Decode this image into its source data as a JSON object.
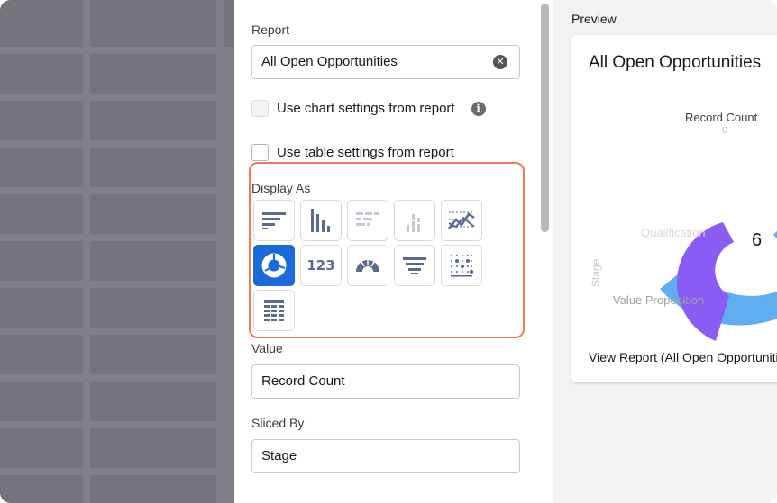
{
  "report": {
    "label": "Report",
    "value": "All Open Opportunities",
    "clear_icon": "clear-icon"
  },
  "options": {
    "chart_settings_label": "Use chart settings from report",
    "table_settings_label": "Use table settings from report"
  },
  "display_as": {
    "label": "Display As",
    "icons": [
      "horizontal-bar-icon",
      "vertical-bar-icon",
      "stacked-horizontal-bar-icon",
      "stacked-vertical-bar-icon",
      "line-chart-icon",
      "donut-icon",
      "metric-icon",
      "gauge-icon",
      "funnel-icon",
      "scatter-icon",
      "table-icon"
    ],
    "metric_glyph": "123",
    "selected": "donut-icon"
  },
  "value_field": {
    "label": "Value",
    "value": "Record Count"
  },
  "sliced_by": {
    "label": "Sliced By",
    "value": "Stage"
  },
  "preview": {
    "heading": "Preview",
    "card_title": "All Open Opportunities",
    "measure_label": "Record Count",
    "axis_zero": "0",
    "axis_label": "Stage",
    "slice_label_1": "Qualification",
    "slice_label_2": "Value Proposition",
    "center_value": "6",
    "view_report_link": "View Report (All Open Opportunities)"
  },
  "colors": {
    "selected_tile": "#1b6ad9",
    "highlight_border": "#f07a53",
    "donut_purple": "#8a5cf5",
    "donut_blue": "#60adf1"
  }
}
